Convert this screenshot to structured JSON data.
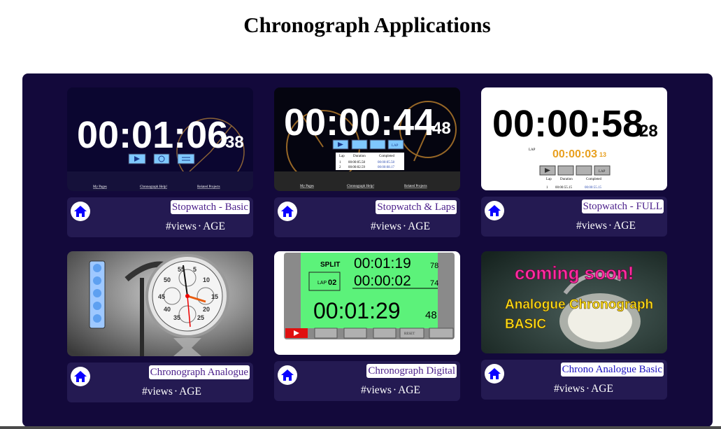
{
  "page": {
    "title": "Chronograph Applications"
  },
  "cards": [
    {
      "title": "Stopwatch - Basic",
      "views": "#views",
      "age": "AGE",
      "thumb": {
        "main": "00:01:06",
        "small": "38",
        "links": [
          "My Pages",
          "Chronograph Help!",
          "Related Projects"
        ]
      }
    },
    {
      "title": "Stopwatch & Laps",
      "views": "#views",
      "age": "AGE",
      "thumb": {
        "main": "00:00:44",
        "small": "48",
        "lap_btn": "LAP",
        "lap_headers": [
          "Lap",
          "Duration",
          "Completed"
        ],
        "lap_rows": [
          [
            "1",
            "00:00:05.58",
            "00:00:05.58"
          ],
          [
            "2",
            "00:00:02.59",
            "00:00:08.17"
          ]
        ],
        "links": [
          "My Pages",
          "Chronograph Help!",
          "Related Projects"
        ]
      }
    },
    {
      "title": "Stopwatch - FULL",
      "views": "#views",
      "age": "AGE",
      "thumb": {
        "main": "00:00:58",
        "small": "28",
        "lap_label": "LAP",
        "lap_time": "00:00:03",
        "lap_small": "13",
        "lap_btn": "LAP",
        "lap_headers": [
          "Lap",
          "Duration",
          "Completed"
        ],
        "lap_rows": [
          [
            "1",
            "00:00:55.15",
            "00:00:55.15"
          ]
        ]
      }
    },
    {
      "title": "Chronograph Analogue",
      "views": "#views",
      "age": "AGE",
      "thumb": {
        "dial_numbers": [
          "55",
          "5",
          "50",
          "10",
          "45",
          "15",
          "40",
          "20",
          "35",
          "25"
        ]
      }
    },
    {
      "title": "Chronograph Digital",
      "views": "#views",
      "age": "AGE",
      "thumb": {
        "split_label": "SPLIT",
        "split_time": "00:01:19",
        "split_small": "78",
        "lap_label": "LAP",
        "lap_num": "02",
        "lap_time": "00:00:02",
        "lap_small": "74",
        "main": "00:01:29",
        "small": "48",
        "reset_label": "RESET"
      }
    },
    {
      "title": "Chrono Analogue Basic",
      "views": "#views",
      "age": "AGE",
      "thumb": {
        "line1": "coming soon!",
        "line2": "Analogue Chronograph",
        "line3": "BASIC"
      }
    }
  ],
  "colors": {
    "panel": "#13093b",
    "card_info": "#241a52",
    "home_icon": "#0a00ff",
    "title_text": "#4a1e8a"
  }
}
